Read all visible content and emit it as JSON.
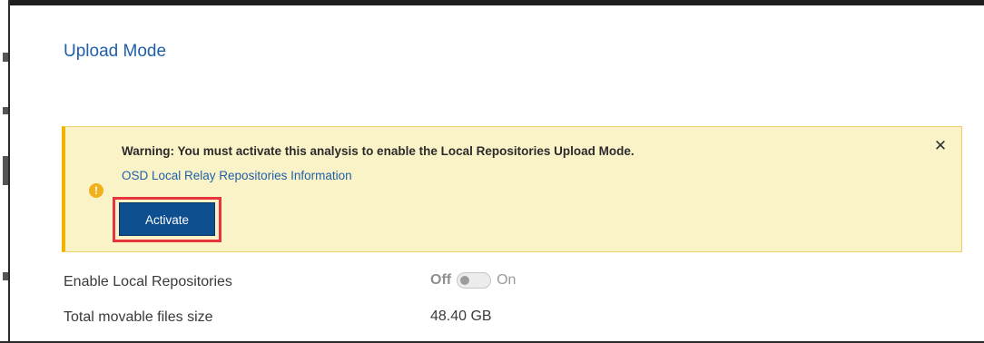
{
  "page": {
    "title": "Upload Mode"
  },
  "warning": {
    "icon": "warning-circle-icon",
    "message": "Warning: You must activate this analysis to enable the Local Repositories Upload Mode.",
    "link_label": "OSD Local Relay Repositories Information",
    "activate_label": "Activate",
    "close_glyph": "✕",
    "background_color": "#fbf3c8",
    "accent_color": "#f0b400",
    "highlight_color": "#e8343c"
  },
  "settings": {
    "enable_local_repositories": {
      "label": "Enable Local Repositories",
      "off_label": "Off",
      "on_label": "On",
      "state": "off"
    },
    "total_movable_files_size": {
      "label": "Total movable files size",
      "value": "48.40 GB"
    }
  },
  "colors": {
    "title": "#1f5fa8",
    "button": "#0d4f8f"
  }
}
